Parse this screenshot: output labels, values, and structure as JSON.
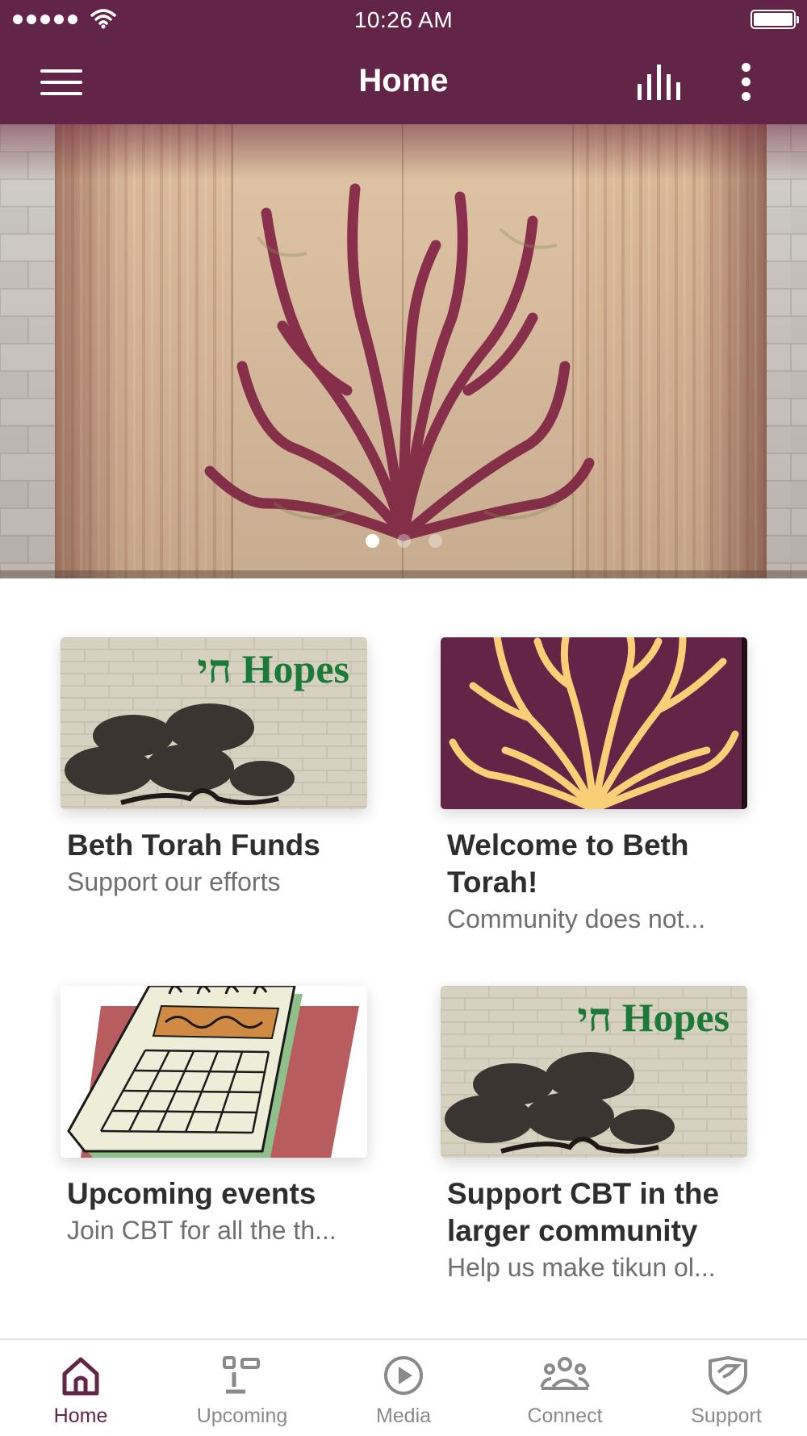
{
  "status_bar": {
    "time": "10:26 AM"
  },
  "header": {
    "title": "Home",
    "menu_icon": "hamburger-menu-icon",
    "actions": [
      "equalizer-icon",
      "more-vertical-icon"
    ]
  },
  "hero": {
    "slide_count": 3,
    "active_slide": 1
  },
  "colors": {
    "brand": "#632547",
    "text_dark": "#2e2e2e",
    "text_muted": "#6f6f6f",
    "tab_inactive": "#8a8a8a"
  },
  "cards": [
    {
      "title": "Beth Torah Funds",
      "subtitle": "Support our efforts",
      "image_text": "חי Hopes"
    },
    {
      "title": "Welcome to Beth Torah!",
      "subtitle": "Community does not..."
    },
    {
      "title": "Upcoming events",
      "subtitle": "Join CBT for all the th..."
    },
    {
      "title": "Support CBT in the larger community",
      "subtitle": "Help us make tikun ol...",
      "image_text": "חי Hopes"
    }
  ],
  "tabs": [
    {
      "label": "Home",
      "icon": "home-icon",
      "active": true
    },
    {
      "label": "Upcoming",
      "icon": "upcoming-icon",
      "active": false
    },
    {
      "label": "Media",
      "icon": "play-circle-icon",
      "active": false
    },
    {
      "label": "Connect",
      "icon": "people-icon",
      "active": false
    },
    {
      "label": "Support",
      "icon": "shield-heart-icon",
      "active": false
    }
  ]
}
